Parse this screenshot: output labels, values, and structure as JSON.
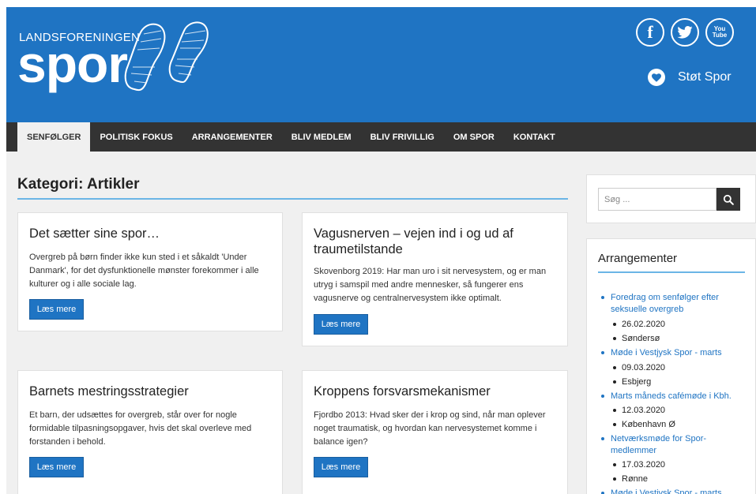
{
  "brand": {
    "small": "LANDSFORENINGEN",
    "big": "spor"
  },
  "social": {
    "facebook": "f",
    "youtube_top": "You",
    "youtube_bottom": "Tube"
  },
  "support_label": "Støt Spor",
  "nav": [
    "SENFØLGER",
    "POLITISK FOKUS",
    "ARRANGEMENTER",
    "BLIV MEDLEM",
    "BLIV FRIVILLIG",
    "OM SPOR",
    "KONTAKT"
  ],
  "page_title": "Kategori: Artikler",
  "articles": [
    {
      "title": "Det sætter sine spor…",
      "excerpt": "Overgreb på børn finder ikke kun sted i et såkaldt 'Under Danmark', for det dysfunktionelle mønster forekommer i alle kulturer og i alle sociale lag.",
      "button": "Læs mere"
    },
    {
      "title": "Vagusnerven – vejen ind i og ud af traumetilstande",
      "excerpt": "Skovenborg 2019: Har man uro i sit nervesystem, og er man utryg i samspil med andre mennesker, så fungerer ens vagusnerve og centralnervesystem ikke optimalt.",
      "button": "Læs mere"
    },
    {
      "title": "Barnets mestringsstrategier",
      "excerpt": "Et barn, der udsættes for overgreb, står over for nogle formidable tilpasningsopgaver, hvis det skal overleve med forstanden i behold.",
      "button": "Læs mere"
    },
    {
      "title": "Kroppens forsvarsmekanismer",
      "excerpt": "Fjordbo 2013: Hvad sker der i krop og sind, når man oplever noget traumatisk, og hvordan kan nervesystemet komme i balance igen?",
      "button": "Læs mere"
    }
  ],
  "search": {
    "placeholder": "Søg ..."
  },
  "events": {
    "title": "Arrangementer",
    "items": [
      {
        "name": "Foredrag om senfølger efter seksuelle overgreb",
        "date": "26.02.2020",
        "place": "Søndersø"
      },
      {
        "name": "Møde i Vestjysk Spor - marts",
        "date": "09.03.2020",
        "place": "Esbjerg"
      },
      {
        "name": "Marts måneds cafémøde i Kbh.",
        "date": "12.03.2020",
        "place": "København Ø"
      },
      {
        "name": "Netværksmøde for Spor-medlemmer",
        "date": "17.03.2020",
        "place": "Rønne"
      },
      {
        "name": "Møde i Vestjysk Spor - marts",
        "date": "",
        "place": ""
      }
    ]
  },
  "colors": {
    "header_blue": "#1f74c3",
    "nav_dark": "#333333",
    "accent_line": "#6bb5e6"
  }
}
